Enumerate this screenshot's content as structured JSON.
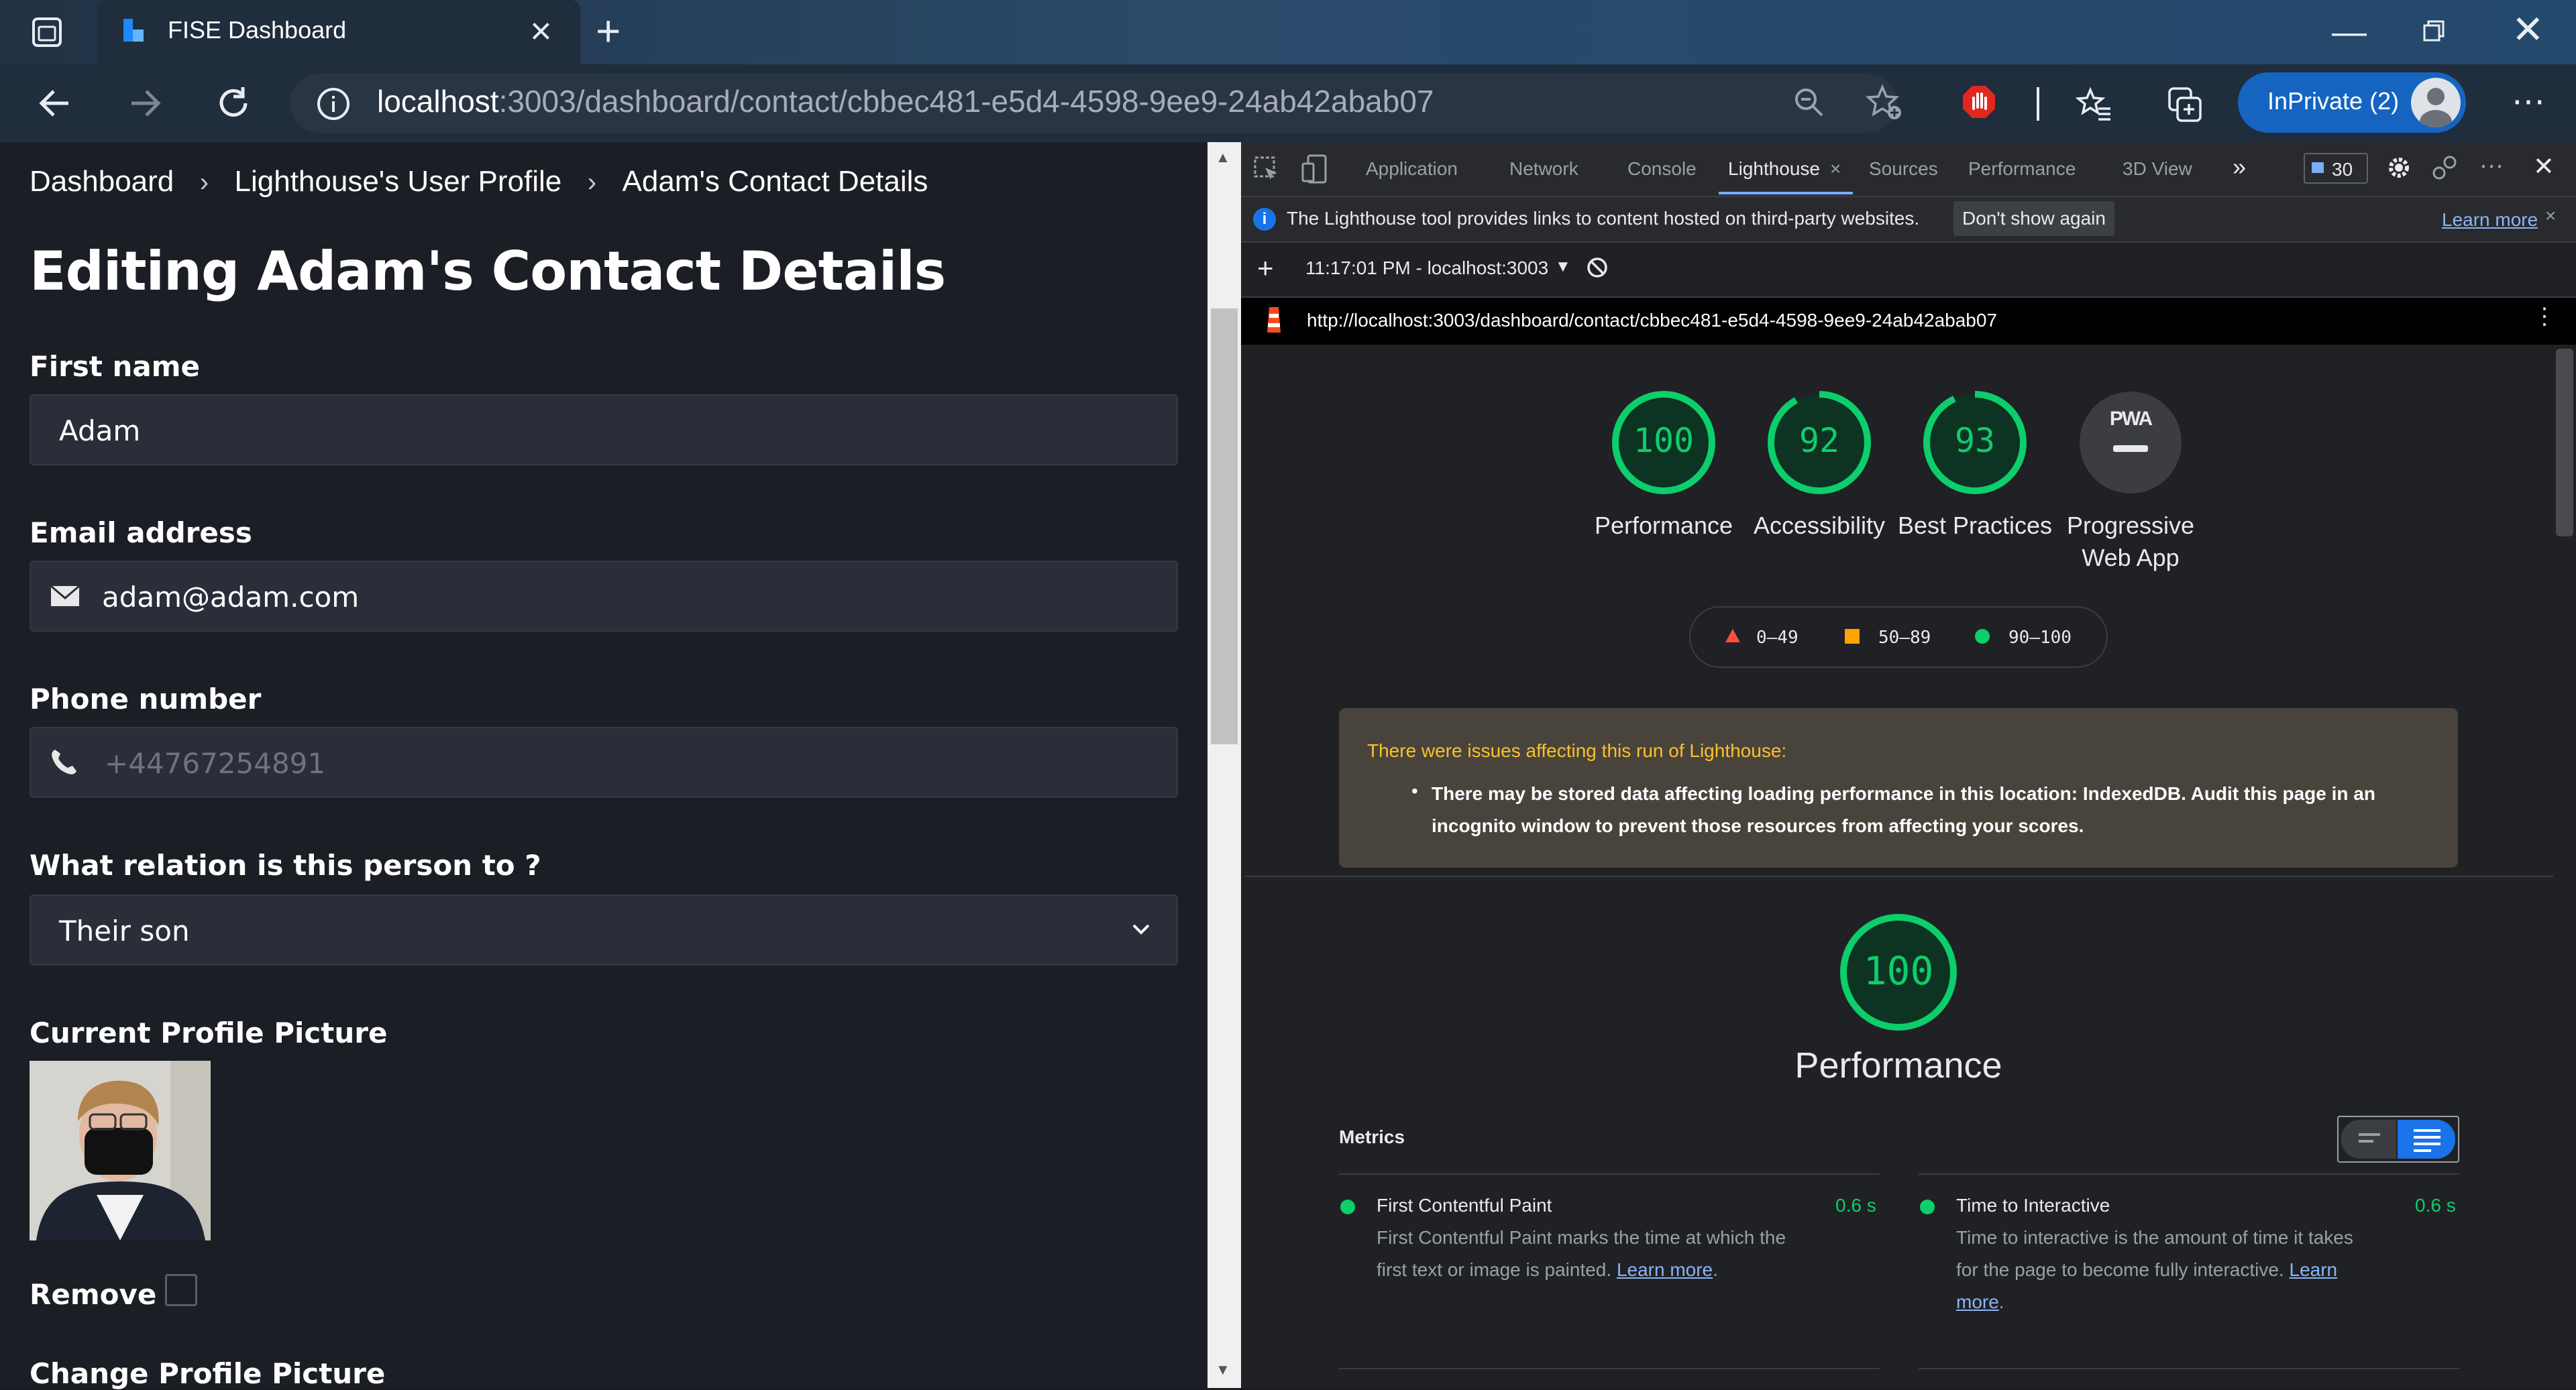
{
  "browser": {
    "tab_title": "FISE Dashboard",
    "url_host": "localhost",
    "url_path": ":3003/dashboard/contact/cbbec481-e5d4-4598-9ee9-24ab42abab07",
    "inprivate_label": "InPrivate (2)",
    "new_tab_icon": "+",
    "close_tab_icon": "×"
  },
  "breadcrumb": {
    "items": [
      "Dashboard",
      "Lighthouse's User Profile",
      "Adam's Contact Details"
    ],
    "separator": "›"
  },
  "page": {
    "title": "Editing Adam's Contact Details",
    "first_name_label": "First name",
    "first_name_value": "Adam",
    "email_label": "Email address",
    "email_value": "adam@adam.com",
    "phone_label": "Phone number",
    "phone_placeholder": "+44767254891",
    "relation_label": "What relation is this person to ?",
    "relation_value": "Their son",
    "current_picture_label": "Current Profile Picture",
    "remove_label": "Remove",
    "change_picture_label": "Change Profile Picture"
  },
  "devtools": {
    "tabs": [
      "Application",
      "Network",
      "Console",
      "Lighthouse",
      "Sources",
      "Performance",
      "3D View"
    ],
    "active_tab": "Lighthouse",
    "issues_count": "30",
    "info_text": "The Lighthouse tool provides links to content hosted on third-party websites.",
    "dont_show_label": "Don't show again",
    "learn_more_label": "Learn more",
    "report_label": "11:17:01 PM - localhost:3003",
    "report_url": "http://localhost:3003/dashboard/contact/cbbec481-e5d4-4598-9ee9-24ab42abab07"
  },
  "lighthouse": {
    "scores": [
      {
        "value": "100",
        "label": "Performance",
        "fraction": 1.0
      },
      {
        "value": "92",
        "label": "Accessibility",
        "fraction": 0.92
      },
      {
        "value": "93",
        "label": "Best Practices",
        "fraction": 0.93
      },
      {
        "value": "PWA",
        "label": "Progressive Web App"
      }
    ],
    "legend": [
      "0–49",
      "50–89",
      "90–100"
    ],
    "colors": {
      "pass": "#0cce6b",
      "average": "#ffa400",
      "fail": "#ff4e42"
    },
    "warning_title": "There were issues affecting this run of Lighthouse:",
    "warning_body": "There may be stored data affecting loading performance in this location: IndexedDB. Audit this page in an incognito window to prevent those resources from affecting your scores.",
    "performance_score": "100",
    "performance_title": "Performance",
    "metrics_label": "Metrics",
    "metrics": [
      {
        "title": "First Contentful Paint",
        "value": "0.6 s",
        "desc": "First Contentful Paint marks the time at which the first text or image is painted.",
        "link": "Learn more"
      },
      {
        "title": "Time to Interactive",
        "value": "0.6 s",
        "desc": "Time to interactive is the amount of time it takes for the page to become fully interactive.",
        "link": "Learn more"
      }
    ]
  }
}
